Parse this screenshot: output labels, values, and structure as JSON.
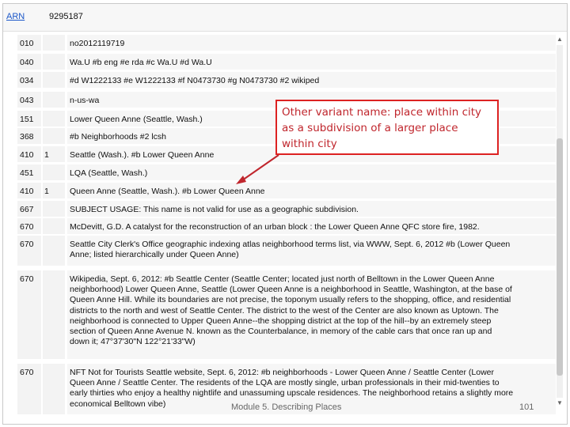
{
  "header": {
    "arn_label": "ARN",
    "arn_value": "9295187"
  },
  "rows": [
    {
      "tag": "010",
      "ind": "",
      "data": "no2012119719"
    },
    {
      "tag": "040",
      "ind": "",
      "data": "Wa.U #b eng #e rda #c Wa.U #d Wa.U"
    },
    {
      "tag": "034",
      "ind": "",
      "data": "#d W1222133 #e W1222133 #f N0473730 #g N0473730 #2 wikiped"
    },
    {
      "tag": "043",
      "ind": "",
      "data": "n-us-wa"
    },
    {
      "tag": "151",
      "ind": "",
      "data": "Lower Queen Anne (Seattle, Wash.)"
    },
    {
      "tag": "368",
      "ind": "",
      "data": "#b Neighborhoods #2 lcsh"
    },
    {
      "tag": "410",
      "ind": "1",
      "data": "Seattle (Wash.). #b Lower Queen Anne"
    },
    {
      "tag": "451",
      "ind": "",
      "data": "LQA (Seattle, Wash.)"
    },
    {
      "tag": "410",
      "ind": "1",
      "data": "Queen Anne (Seattle, Wash.). #b Lower Queen Anne"
    },
    {
      "tag": "667",
      "ind": "",
      "data": "SUBJECT USAGE: This name is not valid for use as a geographic subdivision."
    },
    {
      "tag": "670",
      "ind": "",
      "data": "McDevitt, G.D. A catalyst for the reconstruction of an urban block : the Lower Queen Anne QFC store fire, 1982."
    },
    {
      "tag": "670",
      "ind": "",
      "data": "Seattle City Clerk's Office geographic indexing atlas neighborhood terms list, via WWW, Sept. 6, 2012 #b (Lower Queen\nAnne; listed hierarchically under Queen Anne)"
    },
    {
      "tag": "670",
      "ind": "",
      "data": "Wikipedia, Sept. 6, 2012: #b Seattle Center (Seattle Center; located just north of Belltown in the Lower Queen Anne\nneighborhood) Lower Queen Anne, Seattle (Lower Queen Anne is a neighborhood in Seattle, Washington, at the base of\nQueen Anne Hill. While its boundaries are not precise, the toponym usually refers to the shopping, office, and residential\ndistricts to the north and west of Seattle Center. The district to the west of the Center are also known as Uptown. The\nneighborhood is connected to Upper Queen Anne--the shopping district at the top of the hill--by an extremely steep\nsection of Queen Anne Avenue N. known as the Counterbalance, in memory of the cable cars that once ran up and\ndown it; 47°37'30\"N 122°21'33\"W)"
    },
    {
      "tag": "670",
      "ind": "",
      "data": "NFT Not for Tourists Seattle website, Sept. 6, 2012: #b neighborhoods - Lower Queen Anne / Seattle Center (Lower\nQueen Anne / Seattle Center. The residents of the LQA are mostly single, urban professionals in their mid-twenties to\nearly thirties who enjoy a healthy nightlife and unassuming upscale residences. The neighborhood retains a slightly more\neconomical Belltown vibe)"
    }
  ],
  "callout": {
    "text": "Other variant name: place within city as a subdivision of a larger place within city"
  },
  "footer": {
    "title": "Module 5. Describing Places",
    "page": "101"
  },
  "colors": {
    "link": "#1a56c8",
    "callout": "#c0262d"
  }
}
